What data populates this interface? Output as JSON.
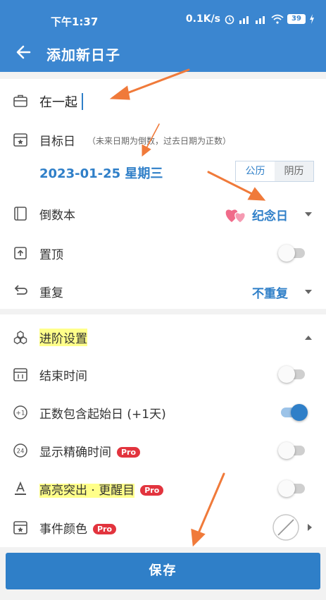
{
  "status_bar": {
    "time": "下午1:37",
    "net_speed": "0.1K/s",
    "battery": "39"
  },
  "app_bar": {
    "title": "添加新日子"
  },
  "form": {
    "name_value": "在一起",
    "target_date_label": "目标日",
    "target_date_hint": "（未来日期为倒数，过去日期为正数）",
    "date_value": "2023-01-25 星期三",
    "calendar_options": [
      "公历",
      "阴历"
    ],
    "calendar_selected": "公历",
    "book_label": "倒数本",
    "book_value": "纪念日",
    "pin_label": "置顶",
    "pin_on": false,
    "repeat_label": "重复",
    "repeat_value": "不重复"
  },
  "advanced": {
    "section_title": "进阶设置",
    "end_time_label": "结束时间",
    "end_time_on": false,
    "include_start_label": "正数包含起始日 (+1天)",
    "include_start_on": true,
    "precise_time_label": "显示精确时间",
    "precise_time_on": false,
    "highlight_label": "高亮突出 · 更醒目",
    "highlight_on": false,
    "color_label": "事件颜色",
    "pro_badge": "Pro"
  },
  "save_button": "保存",
  "colors": {
    "primary": "#3b86d0",
    "accent_blue": "#2f7fc8",
    "pro_red": "#e2343e",
    "annotation_orange": "#f07a3a",
    "highlight_yellow": "#ffff8a"
  }
}
